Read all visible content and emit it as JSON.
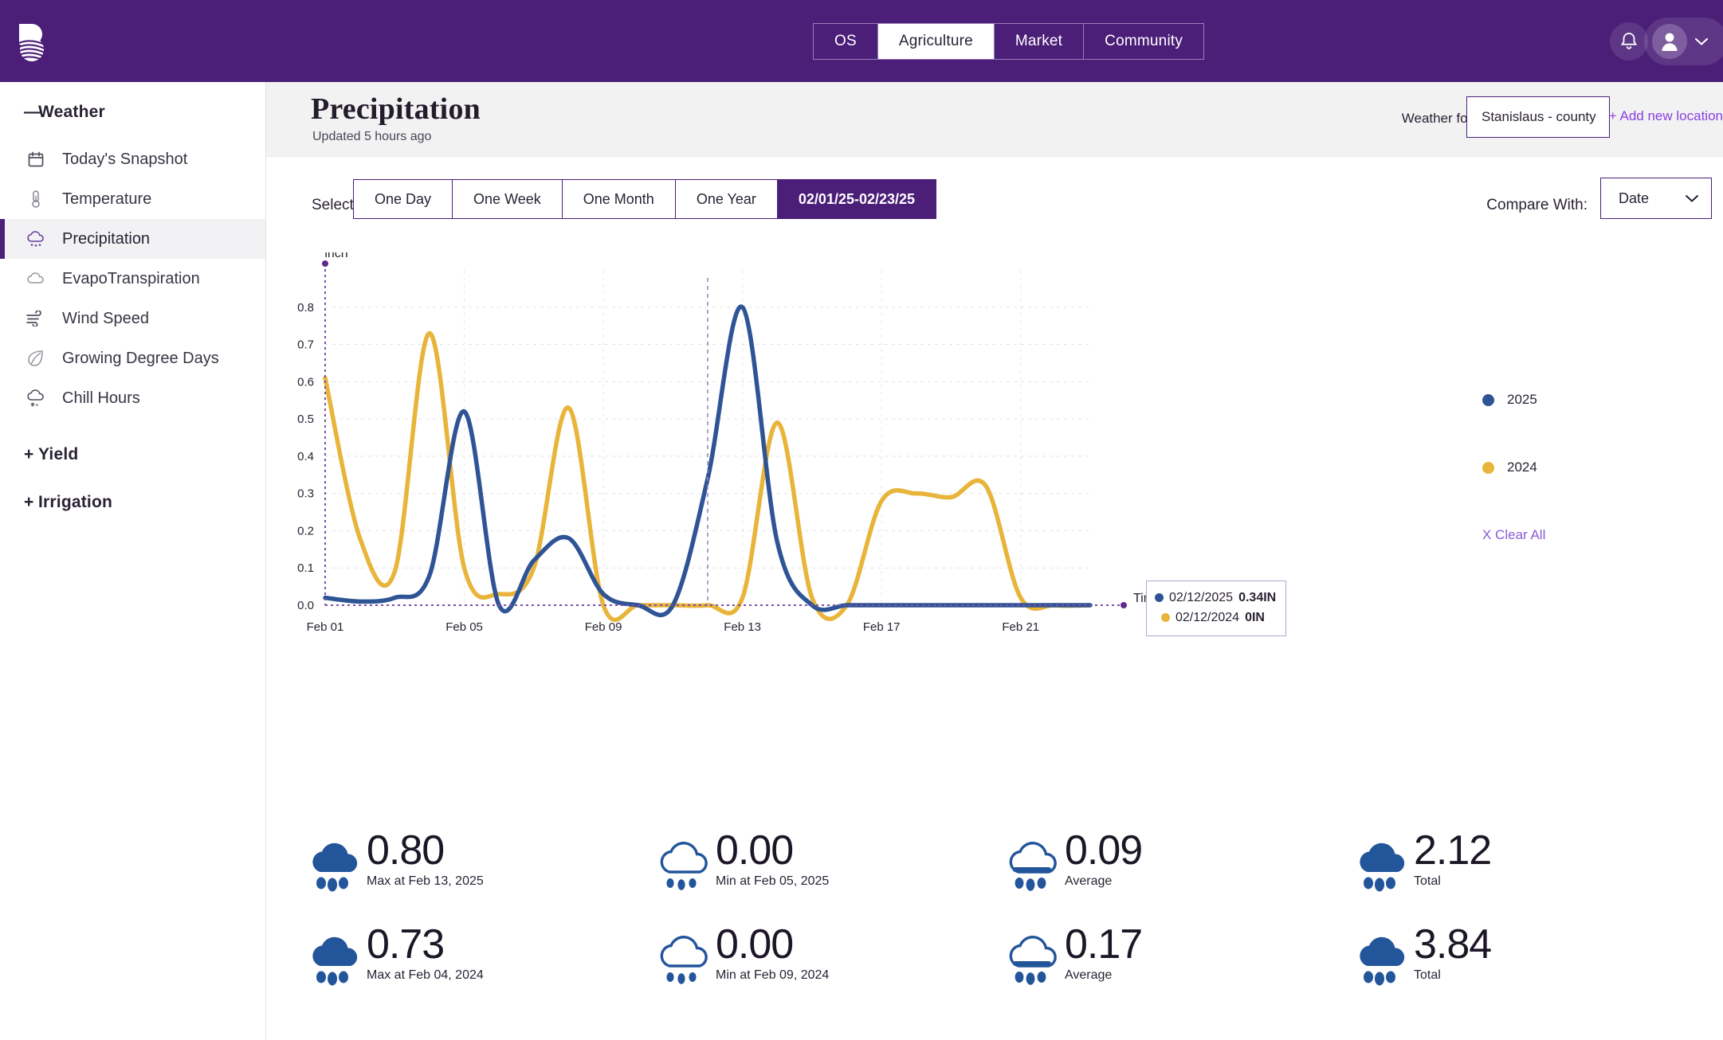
{
  "brand": {
    "logo_icon": "agriculture-field-logo",
    "accent_purple": "#4b1e78",
    "link_purple": "#8b3fe0"
  },
  "topnav": {
    "tabs": [
      {
        "label": "OS",
        "active": false
      },
      {
        "label": "Agriculture",
        "active": true
      },
      {
        "label": "Market",
        "active": false
      },
      {
        "label": "Community",
        "active": false
      }
    ],
    "bell_icon": "notification-bell-icon",
    "avatar_icon": "user-avatar-icon",
    "chevron_icon": "chevron-down-icon"
  },
  "sidebar": {
    "sections": [
      {
        "label": "Weather",
        "sign": "—"
      }
    ],
    "items": [
      {
        "label": "Today's Snapshot",
        "icon": "calendar-icon",
        "active": false
      },
      {
        "label": "Temperature",
        "icon": "thermometer-icon",
        "active": false
      },
      {
        "label": "Precipitation",
        "icon": "rain-cloud-icon",
        "active": true
      },
      {
        "label": "EvapoTranspiration",
        "icon": "cloud-icon",
        "active": false
      },
      {
        "label": "Wind Speed",
        "icon": "wind-icon",
        "active": false
      },
      {
        "label": "Growing Degree Days",
        "icon": "leaf-icon",
        "active": false
      },
      {
        "label": "Chill Hours",
        "icon": "snow-cloud-icon",
        "active": false
      }
    ],
    "groups": [
      {
        "label": "Yield",
        "sign": "+"
      },
      {
        "label": "Irrigation",
        "sign": "+"
      }
    ]
  },
  "header": {
    "title": "Precipitation",
    "updated": "Updated 5 hours ago",
    "weather_for_label": "Weather for:",
    "location_value": "Stanislaus - county",
    "location_chevron": "chevron-down-icon",
    "add_location": "+ Add new location"
  },
  "controls": {
    "select_label": "Select",
    "range_buttons": [
      {
        "label": "One Day",
        "active": false
      },
      {
        "label": "One Week",
        "active": false
      },
      {
        "label": "One Month",
        "active": false
      },
      {
        "label": "One Year",
        "active": false
      },
      {
        "label": "02/01/25-02/23/25",
        "active": true
      }
    ],
    "compare_label": "Compare With:",
    "compare_value": "Date",
    "compare_chevron": "chevron-down-icon"
  },
  "tooltip": {
    "rows": [
      {
        "dot_color": "#2f5496",
        "date": "02/12/2025",
        "value": "0.34IN"
      },
      {
        "dot_color": "#e8b43a",
        "date": "02/12/2024",
        "value": "0IN"
      }
    ]
  },
  "legend": {
    "entries": [
      {
        "label": "2025",
        "color": "#2f5496"
      },
      {
        "label": "2024",
        "color": "#e8b43a"
      }
    ],
    "clear_all": "X Clear All"
  },
  "chart_data": {
    "type": "line",
    "title": "",
    "xlabel": "Time",
    "ylabel": "inch",
    "ylim": [
      0.0,
      0.9
    ],
    "yticks": [
      "0.0",
      "0.1",
      "0.2",
      "0.3",
      "0.4",
      "0.5",
      "0.6",
      "0.7",
      "0.8"
    ],
    "xticks": [
      "Feb 01",
      "Feb 05",
      "Feb 09",
      "Feb 13",
      "Feb 17",
      "Feb 21"
    ],
    "grid": true,
    "legend_position": "right",
    "x": [
      "Feb 01",
      "Feb 02",
      "Feb 03",
      "Feb 04",
      "Feb 05",
      "Feb 06",
      "Feb 07",
      "Feb 08",
      "Feb 09",
      "Feb 10",
      "Feb 11",
      "Feb 12",
      "Feb 13",
      "Feb 14",
      "Feb 15",
      "Feb 16",
      "Feb 17",
      "Feb 18",
      "Feb 19",
      "Feb 20",
      "Feb 21",
      "Feb 22",
      "Feb 23"
    ],
    "series": [
      {
        "name": "2025",
        "color": "#2f5496",
        "values": [
          0.02,
          0.01,
          0.02,
          0.08,
          0.52,
          0.0,
          0.12,
          0.18,
          0.03,
          0.0,
          0.0,
          0.34,
          0.8,
          0.17,
          0.0,
          0.0,
          0.0,
          0.0,
          0.0,
          0.0,
          0.0,
          0.0,
          0.0
        ]
      },
      {
        "name": "2024",
        "color": "#e8b43a",
        "values": [
          0.61,
          0.18,
          0.09,
          0.73,
          0.1,
          0.03,
          0.1,
          0.53,
          0.0,
          0.0,
          0.0,
          0.0,
          0.02,
          0.49,
          0.02,
          0.0,
          0.28,
          0.3,
          0.29,
          0.32,
          0.02,
          0.0,
          0.0
        ]
      }
    ],
    "highlight_date": "02/12"
  },
  "stats": {
    "rows": [
      [
        {
          "icon": "rain-heavy-icon",
          "value": "0.80",
          "label": "Max at Feb 13, 2025"
        },
        {
          "icon": "cloud-drizzle-icon",
          "value": "0.00",
          "label": "Min at Feb 05, 2025"
        },
        {
          "icon": "rain-light-icon",
          "value": "0.09",
          "label": "Average"
        },
        {
          "icon": "rain-heavy-icon",
          "value": "2.12",
          "label": "Total"
        }
      ],
      [
        {
          "icon": "rain-heavy-icon",
          "value": "0.73",
          "label": "Max at Feb 04, 2024"
        },
        {
          "icon": "cloud-drizzle-icon",
          "value": "0.00",
          "label": "Min at Feb 09, 2024"
        },
        {
          "icon": "rain-light-icon",
          "value": "0.17",
          "label": "Average"
        },
        {
          "icon": "rain-heavy-icon",
          "value": "3.84",
          "label": "Total"
        }
      ]
    ]
  }
}
